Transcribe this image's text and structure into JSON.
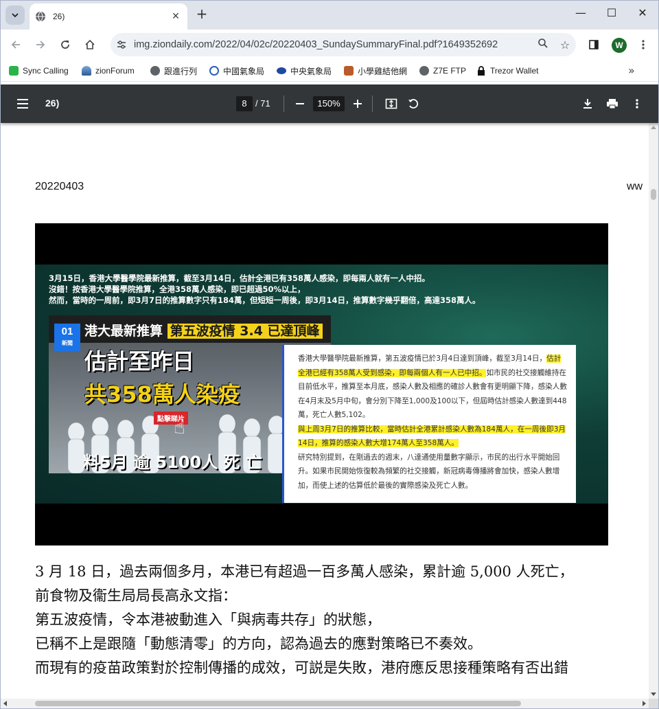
{
  "tab": {
    "title": "26)"
  },
  "omnibox": {
    "url": "img.ziondaily.com/2022/04/02c/20220403_SundaySummaryFinal.pdf?1649352692"
  },
  "profile": {
    "initial": "W",
    "color": "#1e6b2e"
  },
  "bookmarks": [
    {
      "label": "Sync Calling",
      "icon": "sync-calling-icon"
    },
    {
      "label": "zionForum",
      "icon": "zionforum-icon"
    },
    {
      "label": "跟進行列",
      "icon": "globe-icon"
    },
    {
      "label": "中國氣象局",
      "icon": "weather-icon"
    },
    {
      "label": "中央氣象局",
      "icon": "weather-eye-icon"
    },
    {
      "label": "小學雞結他網",
      "icon": "guitar-icon"
    },
    {
      "label": "Z7E FTP",
      "icon": "globe-icon"
    },
    {
      "label": "Trezor Wallet",
      "icon": "lock-icon"
    }
  ],
  "pdf": {
    "title": "26)",
    "page_current": "8",
    "page_total": "/ 71",
    "zoom": "150%"
  },
  "document": {
    "date": "20220403",
    "right_cut": "ww",
    "video": {
      "lines": [
        "3月15日，香港大學醫學院最新推算，截至3月14日，估計全港已有358萬人感染，即每兩人就有一人中招。",
        "沒錯！按香港大學醫學院推算，全港358萬人感染，即已超過50%以上，",
        "然而，當時的一周前，即3月7日的推算數字只有184萬，但短短一周後，即3月14日，推算數字幾乎翻倍，高達358萬人。"
      ],
      "thumb": {
        "logo": "01",
        "logo_sub": "新聞",
        "headline_a": "港大最新推算",
        "headline_b": "第五波疫情 3.4 已達頂峰",
        "big1": "估計至昨日",
        "big2": "共358萬人染疫",
        "click": "點擊睇片",
        "caption": "料5月 逾 5100人 死 亡"
      },
      "quote": {
        "p1_a": "香港大學醫學院最新推算，第五波疫情已於3月4日達到頂峰，截至3月14日，",
        "p1_mark": "估計全港已經有358萬人受到感染，即每兩個人有一人已中招。",
        "p1_b": "如市民的社交接觸維持在目前低水平，推算至本月底，感染人數及相應的確診人數會有更明顯下降，感染人數在4月末及5月中旬，會分別下降至1,000及100以下，但屆時估計感染人數達到448萬，死亡人數5,102。",
        "p2_mark": "與上周3月7日的推算比較，當時估計全港累計感染人數為184萬人，在一周後即3月14日，推算的感染人數大增174萬人至358萬人。",
        "p3": "研究特別提到，在剛過去的週末，八達通使用量數字顯示，市民的出行水平開始回升。如果市民開始恢復較為頻繁的社交接觸，新冠病毒傳播將會加快，感染人數增加，而使上述的估算低於最後的實際感染及死亡人數。"
      }
    },
    "paragraph": [
      "3 月 18 日，過去兩個多月，本港已有超過一百多萬人感染，累計逾 5,000 人死亡，",
      "前食物及衞生局局長高永文指：",
      "第五波疫情，令本港被動進入「與病毒共存」的狀態，",
      "已稱不上是跟隨「動態清零」的方向，認為過去的應對策略已不奏效。",
      "而現有的疫苗政策對於控制傳播的成效，可説是失敗，港府應反思接種策略有否出錯"
    ]
  }
}
